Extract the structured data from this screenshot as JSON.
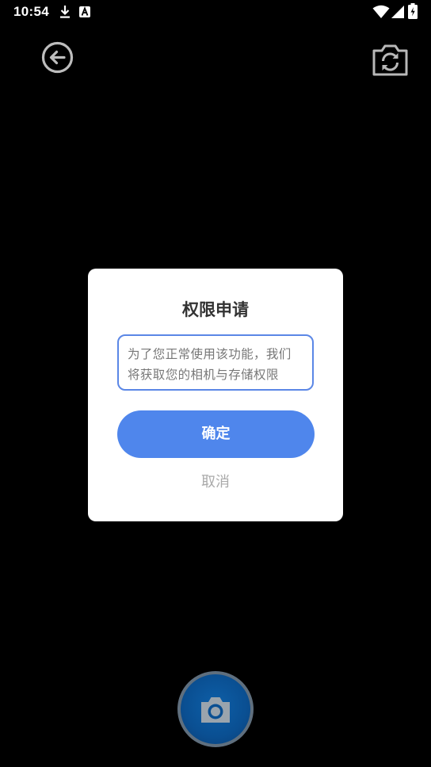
{
  "status_bar": {
    "time": "10:54",
    "icons": [
      "download-icon",
      "a-notification-icon",
      "wifi-icon",
      "signal-icon",
      "battery-icon"
    ]
  },
  "camera": {
    "back_icon": "arrow-left-circle-icon",
    "switch_icon": "camera-switch-icon",
    "shutter_icon": "camera-icon"
  },
  "dialog": {
    "title": "权限申请",
    "message_line1": "为了您正常使用该功能，我们",
    "message_line2": "将获取您的相机与存储权限",
    "confirm_label": "确定",
    "cancel_label": "取消"
  },
  "colors": {
    "accent": "#4f86ec",
    "message_border": "#5b87e6",
    "background": "#000000",
    "shutter": "#0a4f92"
  }
}
